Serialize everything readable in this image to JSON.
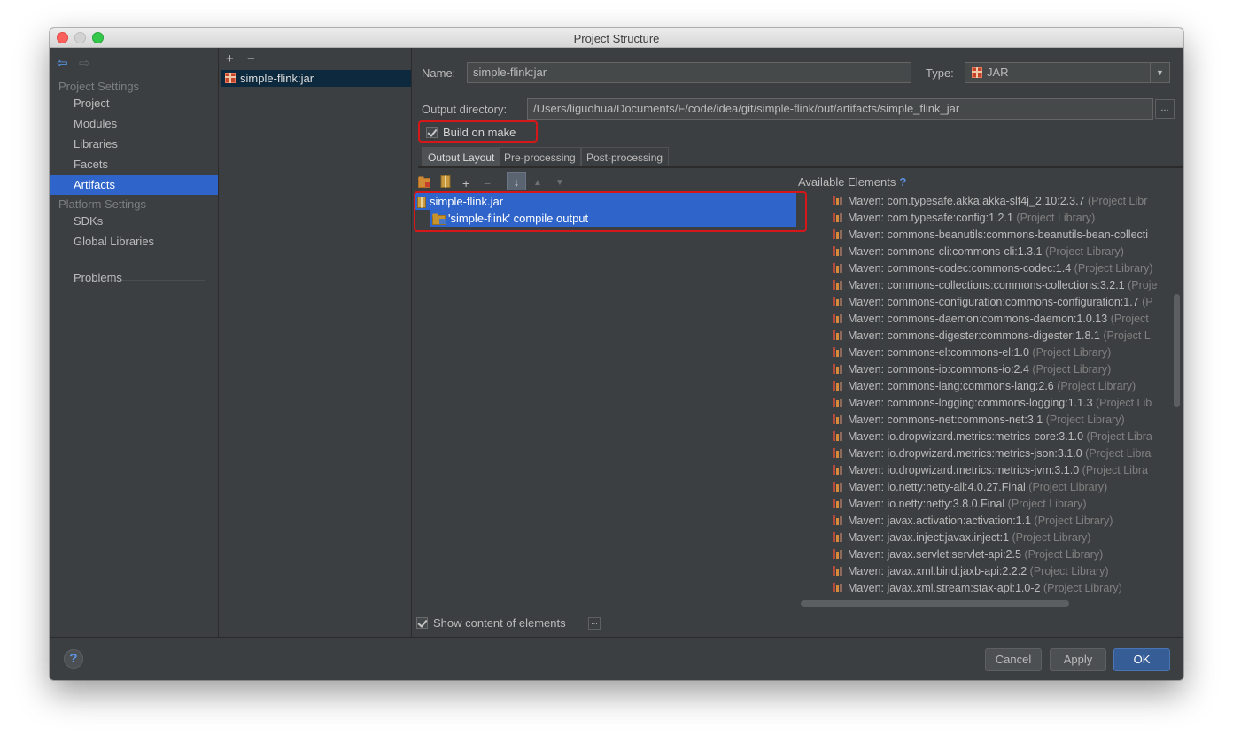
{
  "window": {
    "title": "Project Structure"
  },
  "sidebar": {
    "back_icon": "arrow-back-icon",
    "forward_icon": "arrow-forward-icon",
    "project_settings_header": "Project Settings",
    "platform_settings_header": "Platform Settings",
    "items": [
      {
        "label": "Project"
      },
      {
        "label": "Modules"
      },
      {
        "label": "Libraries"
      },
      {
        "label": "Facets"
      },
      {
        "label": "Artifacts",
        "selected": true
      },
      {
        "label": "SDKs"
      },
      {
        "label": "Global Libraries"
      },
      {
        "label": "Problems"
      }
    ]
  },
  "artifacts_panel": {
    "add_icon": "+",
    "remove_icon": "−",
    "items": [
      {
        "label": "simple-flink:jar",
        "selected": true
      }
    ]
  },
  "details": {
    "name_label": "Name:",
    "name_value": "simple-flink:jar",
    "type_label": "Type:",
    "type_value": "JAR",
    "output_dir_label": "Output directory:",
    "output_dir_value": "/Users/liguohua/Documents/F/code/idea/git/simple-flink/out/artifacts/simple_flink_jar",
    "browse_label": "...",
    "build_on_make_label": "Build on make",
    "build_on_make_checked": true,
    "tabs": [
      {
        "label": "Output Layout",
        "active": true
      },
      {
        "label": "Pre-processing"
      },
      {
        "label": "Post-processing"
      }
    ],
    "show_content_label": "Show content of elements",
    "show_content_checked": true,
    "show_content_more": "..."
  },
  "output_layout": {
    "toolbar": {
      "plus": "+",
      "minus": "−",
      "sort": "↓",
      "up": "▲",
      "down": "▼"
    },
    "tree": [
      {
        "label": "simple-flink.jar",
        "icon": "jar-icon"
      },
      {
        "label": "'simple-flink' compile output",
        "icon": "module-output-folder-icon"
      }
    ]
  },
  "available_elements": {
    "title": "Available Elements",
    "help": "?",
    "items": [
      {
        "name": "Maven: com.typesafe.akka:akka-slf4j_2.10:2.3.7",
        "suffix": "(Project Libr"
      },
      {
        "name": "Maven: com.typesafe:config:1.2.1",
        "suffix": "(Project Library)"
      },
      {
        "name": "Maven: commons-beanutils:commons-beanutils-bean-collecti",
        "suffix": ""
      },
      {
        "name": "Maven: commons-cli:commons-cli:1.3.1",
        "suffix": "(Project Library)"
      },
      {
        "name": "Maven: commons-codec:commons-codec:1.4",
        "suffix": "(Project Library)"
      },
      {
        "name": "Maven: commons-collections:commons-collections:3.2.1",
        "suffix": "(Proje"
      },
      {
        "name": "Maven: commons-configuration:commons-configuration:1.7",
        "suffix": "(P"
      },
      {
        "name": "Maven: commons-daemon:commons-daemon:1.0.13",
        "suffix": "(Project"
      },
      {
        "name": "Maven: commons-digester:commons-digester:1.8.1",
        "suffix": "(Project L"
      },
      {
        "name": "Maven: commons-el:commons-el:1.0",
        "suffix": "(Project Library)"
      },
      {
        "name": "Maven: commons-io:commons-io:2.4",
        "suffix": "(Project Library)"
      },
      {
        "name": "Maven: commons-lang:commons-lang:2.6",
        "suffix": "(Project Library)"
      },
      {
        "name": "Maven: commons-logging:commons-logging:1.1.3",
        "suffix": "(Project Lib"
      },
      {
        "name": "Maven: commons-net:commons-net:3.1",
        "suffix": "(Project Library)"
      },
      {
        "name": "Maven: io.dropwizard.metrics:metrics-core:3.1.0",
        "suffix": "(Project Libra"
      },
      {
        "name": "Maven: io.dropwizard.metrics:metrics-json:3.1.0",
        "suffix": "(Project Libra"
      },
      {
        "name": "Maven: io.dropwizard.metrics:metrics-jvm:3.1.0",
        "suffix": "(Project Libra"
      },
      {
        "name": "Maven: io.netty:netty-all:4.0.27.Final",
        "suffix": "(Project Library)"
      },
      {
        "name": "Maven: io.netty:netty:3.8.0.Final",
        "suffix": "(Project Library)"
      },
      {
        "name": "Maven: javax.activation:activation:1.1",
        "suffix": "(Project Library)"
      },
      {
        "name": "Maven: javax.inject:javax.inject:1",
        "suffix": "(Project Library)"
      },
      {
        "name": "Maven: javax.servlet:servlet-api:2.5",
        "suffix": "(Project Library)"
      },
      {
        "name": "Maven: javax.xml.bind:jaxb-api:2.2.2",
        "suffix": "(Project Library)"
      },
      {
        "name": "Maven: javax.xml.stream:stax-api:1.0-2",
        "suffix": "(Project Library)"
      }
    ]
  },
  "buttons": {
    "help": "?",
    "cancel": "Cancel",
    "apply": "Apply",
    "ok": "OK"
  },
  "colors": {
    "background": "#3c3f41",
    "selection": "#2f65ca",
    "highlight_box": "#d5171a",
    "primary_button": "#375d97"
  }
}
